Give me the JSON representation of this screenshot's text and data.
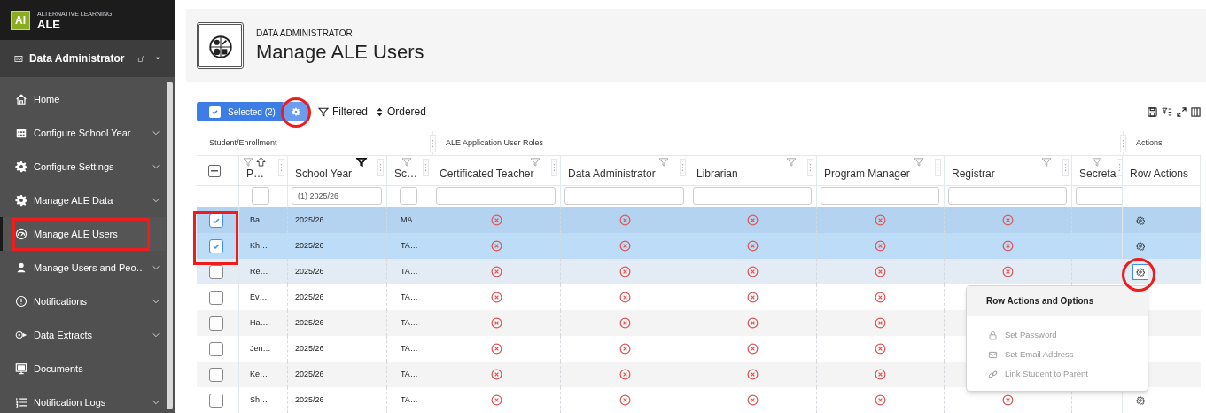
{
  "app": {
    "logo": "AI",
    "subtitle": "ALTERNATIVE LEARNING",
    "name": "ALE"
  },
  "role_switcher": {
    "label": "Data Administrator"
  },
  "sidebar": {
    "items": [
      {
        "label": "Home",
        "expandable": false,
        "selected": false,
        "annotated": false
      },
      {
        "label": "Configure School Year",
        "expandable": true,
        "selected": false,
        "annotated": false
      },
      {
        "label": "Configure Settings",
        "expandable": true,
        "selected": false,
        "annotated": false
      },
      {
        "label": "Manage ALE Data",
        "expandable": true,
        "selected": false,
        "annotated": false
      },
      {
        "label": "Manage ALE Users",
        "expandable": false,
        "selected": true,
        "annotated": true
      },
      {
        "label": "Manage Users and Peo…",
        "expandable": true,
        "selected": false,
        "annotated": false
      },
      {
        "label": "Notifications",
        "expandable": true,
        "selected": false,
        "annotated": false
      },
      {
        "label": "Data Extracts",
        "expandable": true,
        "selected": false,
        "annotated": false
      },
      {
        "label": "Documents",
        "expandable": false,
        "selected": false,
        "annotated": false
      },
      {
        "label": "Notification Logs",
        "expandable": true,
        "selected": false,
        "annotated": false
      }
    ]
  },
  "page": {
    "eyebrow": "DATA ADMINISTRATOR",
    "title": "Manage ALE Users"
  },
  "toolbar": {
    "selected_label": "Selected (2)",
    "settings_annotated": true,
    "filtered": "Filtered",
    "ordered": "Ordered"
  },
  "table": {
    "groups": [
      {
        "label": "Student/Enrollment"
      },
      {
        "label": "ALE Application User Roles"
      },
      {
        "label": "Actions"
      }
    ],
    "header_checkbox": {
      "indeterminate": true
    },
    "columns": [
      {
        "label": "P…",
        "filter_active": false,
        "sorted": true
      },
      {
        "label": "School Year",
        "filter_active": true,
        "sorted": false,
        "filter_value": "(1) 2025/26"
      },
      {
        "label": "Sc…",
        "filter_active": false,
        "sorted": false
      },
      {
        "label": "Certificated Teacher",
        "filter_active": false,
        "sorted": false
      },
      {
        "label": "Data Administrator",
        "filter_active": false,
        "sorted": false
      },
      {
        "label": "Librarian",
        "filter_active": false,
        "sorted": false
      },
      {
        "label": "Program Manager",
        "filter_active": false,
        "sorted": false
      },
      {
        "label": "Registrar",
        "filter_active": false,
        "sorted": false
      },
      {
        "label": "Secreta",
        "filter_active": false,
        "sorted": false
      },
      {
        "label": "Row Actions"
      }
    ],
    "rows": [
      {
        "selected": true,
        "focused": false,
        "name": "Ba…",
        "year": "2025/26",
        "school": "MA…",
        "roles": [
          false,
          false,
          false,
          false,
          false
        ],
        "action_button": true
      },
      {
        "selected": true,
        "focused": false,
        "name": "Kh…",
        "year": "2025/26",
        "school": "TA…",
        "roles": [
          false,
          false,
          false,
          false,
          false
        ],
        "action_button": true
      },
      {
        "selected": false,
        "focused": true,
        "name": "Re…",
        "year": "2025/26",
        "school": "TA…",
        "roles": [
          false,
          false,
          false,
          false,
          false
        ],
        "action_button": true
      },
      {
        "selected": false,
        "focused": false,
        "name": "Ev…",
        "year": "2025/26",
        "school": "TA…",
        "roles": [
          false,
          false,
          false,
          false
        ]
      },
      {
        "selected": false,
        "focused": false,
        "name": "Ha…",
        "year": "2025/26",
        "school": "TA…",
        "roles": [
          false,
          false,
          false,
          false
        ]
      },
      {
        "selected": false,
        "focused": false,
        "name": "Jen…",
        "year": "2025/26",
        "school": "TA…",
        "roles": [
          false,
          false,
          false,
          false
        ]
      },
      {
        "selected": false,
        "focused": false,
        "name": "Ke…",
        "year": "2025/26",
        "school": "TA…",
        "roles": [
          false,
          false,
          false,
          false
        ]
      },
      {
        "selected": false,
        "focused": false,
        "name": "Sh…",
        "year": "2025/26",
        "school": "TA…",
        "roles": [
          false,
          false,
          false,
          false,
          false
        ],
        "action_button": true
      }
    ],
    "checkbox_annotated": true,
    "row_action_annotated": true
  },
  "row_menu": {
    "title": "Row Actions and Options",
    "items": [
      {
        "label": "Set Password",
        "disabled": true
      },
      {
        "label": "Set Email Address",
        "disabled": true
      },
      {
        "label": "Link Student to Parent",
        "disabled": true
      }
    ]
  }
}
